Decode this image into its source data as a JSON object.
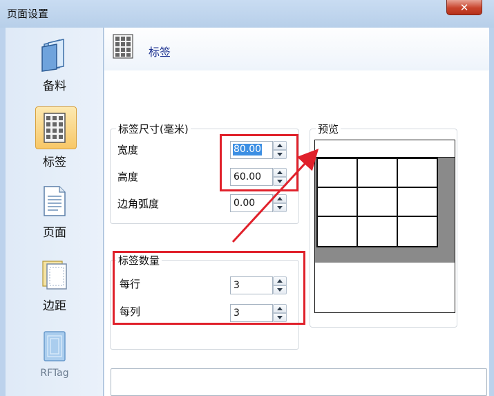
{
  "window": {
    "title": "页面设置",
    "close_label": "✕"
  },
  "sidebar": {
    "items": [
      {
        "label": "备料",
        "icon": "folder-icon"
      },
      {
        "label": "标签",
        "icon": "label-grid-icon",
        "selected": true
      },
      {
        "label": "页面",
        "icon": "page-icon"
      },
      {
        "label": "边距",
        "icon": "margin-icon"
      },
      {
        "label": "RFTag",
        "icon": "rftag-icon"
      }
    ]
  },
  "header": {
    "title": "标签"
  },
  "label_size": {
    "title": "标签尺寸(毫米)",
    "width_label": "宽度",
    "width_value": "80.00",
    "height_label": "高度",
    "height_value": "60.00",
    "radius_label": "边角弧度",
    "radius_value": "0.00"
  },
  "label_count": {
    "title": "标签数量",
    "per_row_label": "每行",
    "per_row_value": "3",
    "per_col_label": "每列",
    "per_col_value": "3"
  },
  "preview": {
    "title": "预览",
    "rows": 3,
    "cols": 3
  },
  "colors": {
    "annotation": "#e0212b",
    "selected_item": "#f7c767",
    "header_text": "#1a2f8f"
  }
}
